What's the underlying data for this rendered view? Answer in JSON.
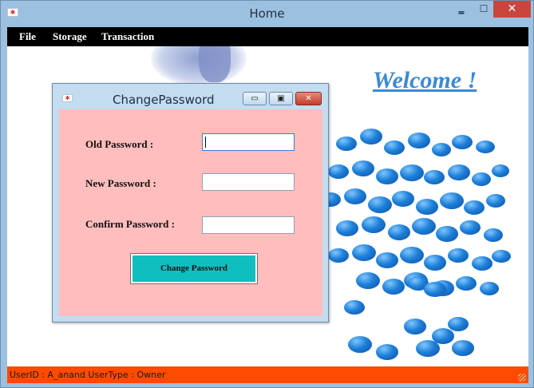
{
  "window": {
    "title": "Home",
    "icon": "app-icon",
    "min_glyph": "‗",
    "max_glyph": "☐",
    "close_glyph": "✕"
  },
  "menu": {
    "items": [
      "File",
      "Storage",
      "Transaction"
    ]
  },
  "content": {
    "welcome": "Welcome !"
  },
  "dialog": {
    "title": "ChangePassword",
    "min_glyph": "▭",
    "max_glyph": "▣",
    "close_glyph": "✕",
    "fields": [
      {
        "label": "Old Password :",
        "value": ""
      },
      {
        "label": "New Password :",
        "value": ""
      },
      {
        "label": "Confirm Password :",
        "value": ""
      }
    ],
    "submit_label": "Change Password"
  },
  "status": {
    "text": "UserID :  A_anand  UserType :  Owner"
  },
  "colors": {
    "status_bar": "#ff4a00",
    "dialog_body": "#ffbdbd",
    "button": "#0fbfbf",
    "welcome": "#3a8ad8"
  }
}
